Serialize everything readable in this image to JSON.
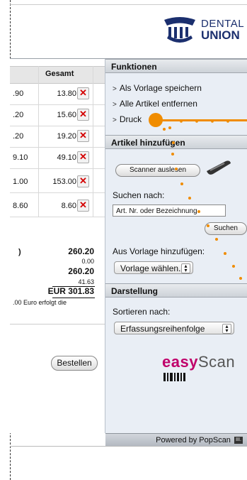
{
  "brand": {
    "line1": "DENTAL",
    "line2": "UNION",
    "emblem": "DENTAL UNION emblem"
  },
  "table": {
    "header": {
      "gesamt": "Gesamt"
    },
    "rows": [
      {
        "price": ".90",
        "total": "13.80"
      },
      {
        "price": ".20",
        "total": "15.60"
      },
      {
        "price": ".20",
        "total": "19.20"
      },
      {
        "price": "9.10",
        "total": "49.10"
      },
      {
        "price": "1.00",
        "total": "153.00"
      },
      {
        "price": "8.60",
        "total": "8.60"
      }
    ],
    "delete_symbol": "✕"
  },
  "totals": {
    "left_marker": ")",
    "subtotal": "260.20",
    "shipping": "0.00",
    "net": "260.20",
    "vat": "41.63",
    "grand": "EUR 301.83",
    "note": ".00 Euro erfolgt die"
  },
  "order_button": "Bestellen",
  "panel": {
    "funktionen": {
      "title": "Funktionen",
      "items": [
        "Als Vorlage speichern",
        "Alle Artikel entfernen",
        "Druck"
      ]
    },
    "artikel": {
      "title": "Artikel hinzufügen",
      "scanner_button": "Scanner auslesen",
      "search_label": "Suchen nach:",
      "search_value": "Art. Nr. oder Bezeichnung",
      "search_button": "Suchen",
      "template_label": "Aus Vorlage hinzufügen:",
      "template_select": "Vorlage wählen..."
    },
    "darstellung": {
      "title": "Darstellung",
      "sort_label": "Sortieren nach:",
      "sort_select": "Erfassungsreihenfolge"
    },
    "easyscan": {
      "easy": "easy",
      "scan": "Scan"
    }
  },
  "footer": {
    "powered": "Powered by PopScan",
    "logo_text": "III."
  },
  "colors": {
    "accent_orange": "#f08c00",
    "brand_blue": "#1b2f6e",
    "delete_red": "#d40000",
    "easy_magenta": "#c0006a"
  }
}
